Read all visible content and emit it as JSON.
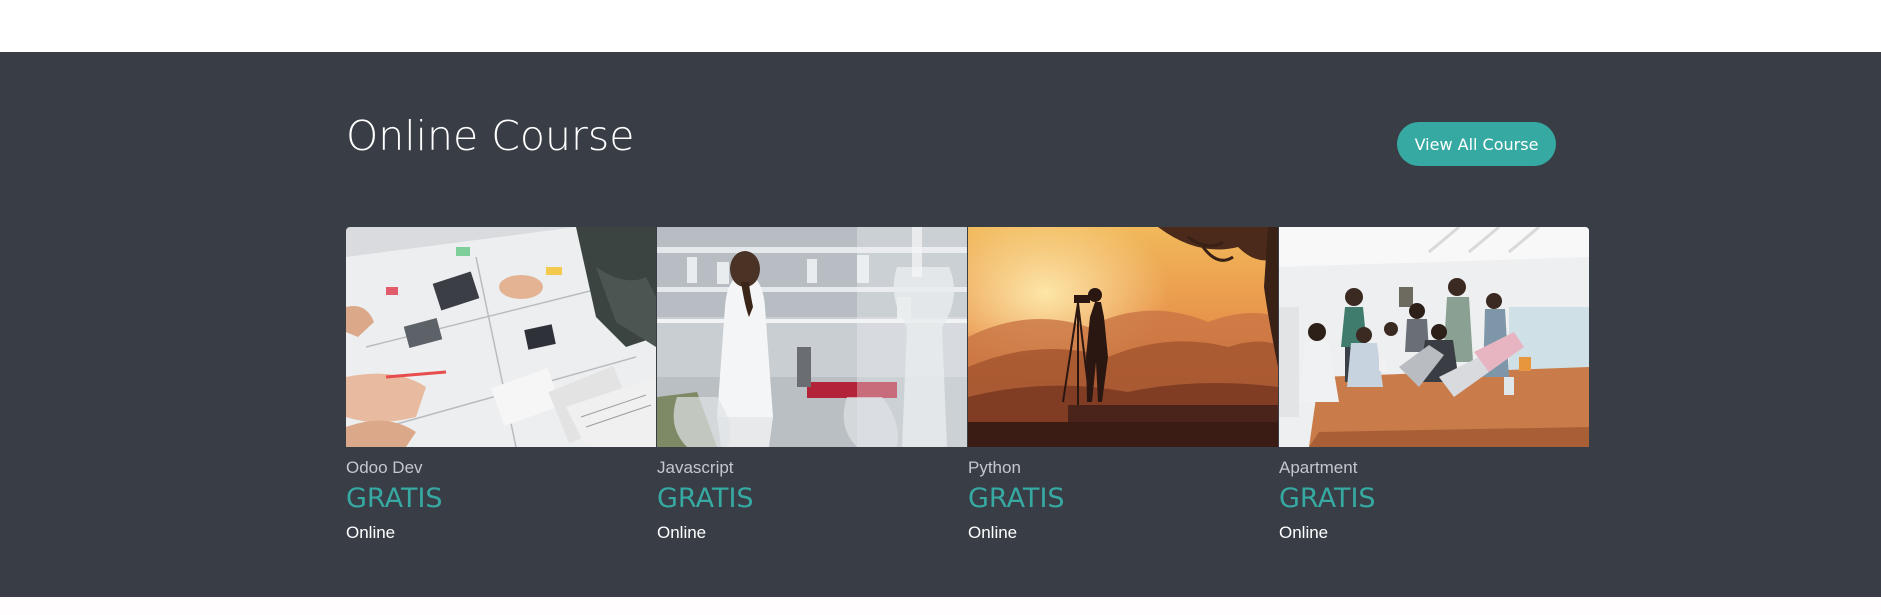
{
  "section": {
    "title": "Online Course",
    "view_all_label": "View All Course",
    "accent_color": "#36a9a2",
    "background_color": "#383d46"
  },
  "courses": [
    {
      "name": "Odoo Dev",
      "price": "GRATIS",
      "mode": "Online",
      "image": "people-planning-papers-photo"
    },
    {
      "name": "Javascript",
      "price": "GRATIS",
      "mode": "Online",
      "image": "laboratory-scientist-photo"
    },
    {
      "name": "Python",
      "price": "GRATIS",
      "mode": "Online",
      "image": "sunset-photographer-photo"
    },
    {
      "name": "Apartment",
      "price": "GRATIS",
      "mode": "Online",
      "image": "team-meeting-laptops-photo"
    }
  ]
}
